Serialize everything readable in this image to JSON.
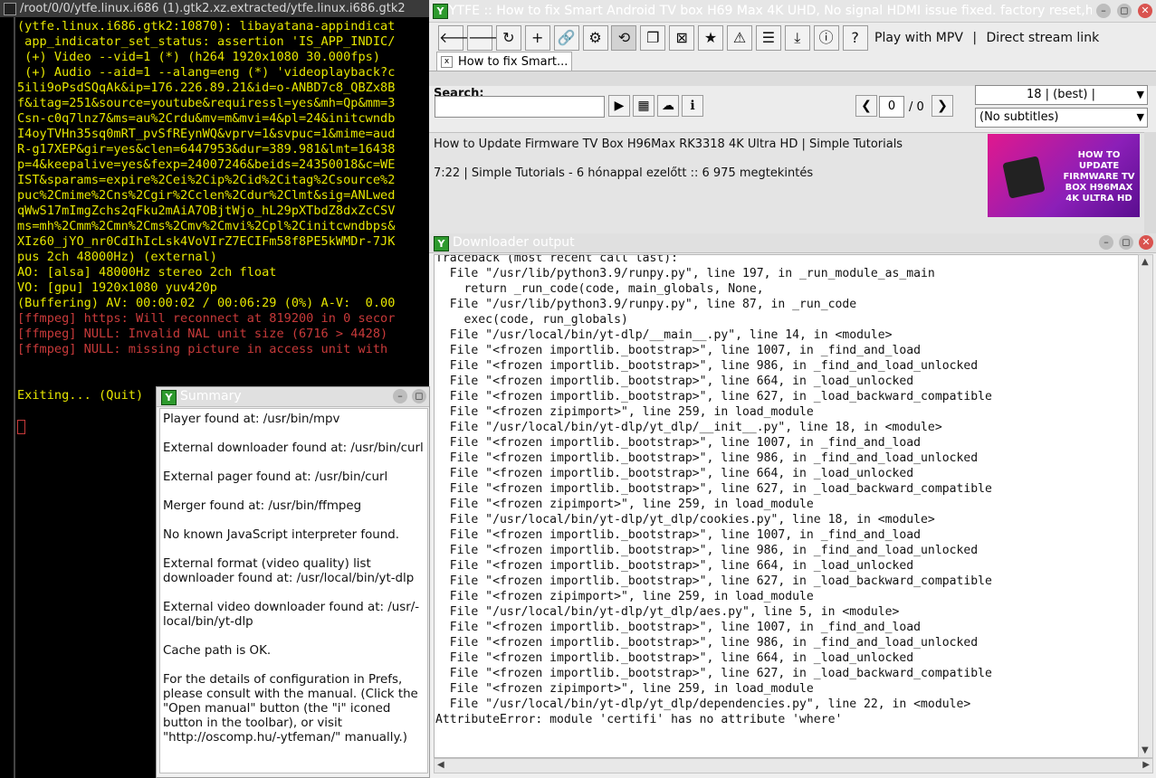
{
  "terminal": {
    "title": "/root/0/0/ytfe.linux.i686 (1).gtk2.xz.extracted/ytfe.linux.i686.gtk2",
    "lines": [
      {
        "text": "(ytfe.linux.i686.gtk2:10870): libayatana-appindicat",
        "red": false
      },
      {
        "text": " app_indicator_set_status: assertion 'IS_APP_INDIC/",
        "red": false
      },
      {
        "text": " (+) Video --vid=1 (*) (h264 1920x1080 30.000fps)",
        "red": false
      },
      {
        "text": " (+) Audio --aid=1 --alang=eng (*) 'videoplayback?c",
        "red": false
      },
      {
        "text": "5ili9oPsdSQqAk&ip=176.226.89.21&id=o-ANBD7c8_QBZx8B",
        "red": false
      },
      {
        "text": "f&itag=251&source=youtube&requiressl=yes&mh=Qp&mm=3",
        "red": false
      },
      {
        "text": "Csn-c0q7lnz7&ms=au%2Crdu&mv=m&mvi=4&pl=24&initcwndb",
        "red": false
      },
      {
        "text": "I4oyTVHn35sq0mRT_pvSfREynWQ&vprv=1&svpuc=1&mime=aud",
        "red": false
      },
      {
        "text": "R-g17XEP&gir=yes&clen=6447953&dur=389.981&lmt=16438",
        "red": false
      },
      {
        "text": "p=4&keepalive=yes&fexp=24007246&beids=24350018&c=WE",
        "red": false
      },
      {
        "text": "IST&sparams=expire%2Cei%2Cip%2Cid%2Citag%2Csource%2",
        "red": false
      },
      {
        "text": "puc%2Cmime%2Cns%2Cgir%2Cclen%2Cdur%2Clmt&sig=ANLwed",
        "red": false
      },
      {
        "text": "qWwS17mImgZchs2qFku2mAiA7OBjtWjo_hL29pXTbdZ8dxZcCSV",
        "red": false
      },
      {
        "text": "ms=mh%2Cmm%2Cmn%2Cms%2Cmv%2Cmvi%2Cpl%2Cinitcwndbps&",
        "red": false
      },
      {
        "text": "XIz60_jYO_nr0CdIhIcLsk4VoVIrZ7ECIFm58f8PE5kWMDr-7JK",
        "red": false
      },
      {
        "text": "pus 2ch 48000Hz) (external)",
        "red": false
      },
      {
        "text": "AO: [alsa] 48000Hz stereo 2ch float",
        "red": false
      },
      {
        "text": "VO: [gpu] 1920x1080 yuv420p",
        "red": false
      },
      {
        "text": "(Buffering) AV: 00:00:02 / 00:06:29 (0%) A-V:  0.00",
        "red": false
      },
      {
        "text": "[ffmpeg] https: Will reconnect at 819200 in 0 secor",
        "red": true
      },
      {
        "text": "[ffmpeg] NULL: Invalid NAL unit size (6716 > 4428)",
        "red": true
      },
      {
        "text": "[ffmpeg] NULL: missing picture in access unit with",
        "red": true
      },
      {
        "text": "",
        "red": false
      },
      {
        "text": "",
        "red": false
      },
      {
        "text": "Exiting... (Quit)",
        "red": false
      }
    ]
  },
  "ytfe": {
    "title": "YTFE :: How to fix Smart Android TV box H69 Max 4K UHD, No signal HDMI issue fixed. factory reset,hard res",
    "app_icon": "Y",
    "toolbar_icons": [
      "arrow-left-icon",
      "arrow-right-icon",
      "reload-icon",
      "plus-icon",
      "link-icon",
      "gear-icon",
      "history-icon",
      "copy-icon",
      "close-box-icon",
      "star-icon",
      "warning-icon",
      "list-icon",
      "download-icon",
      "info-icon",
      "help-icon"
    ],
    "toolbar_glyphs": [
      "🡐",
      "🡒",
      "↻",
      "+",
      "🔗",
      "⚙",
      "⟲",
      "❐",
      "⊠",
      "★",
      "⚠",
      "☰",
      "⤓",
      "ⓘ",
      "?"
    ],
    "play_mpv": "Play with MPV",
    "separator": "|",
    "direct_stream": "Direct stream link",
    "tab_label": "How to fix Smart...",
    "tab_close": "x",
    "search_label": "Search:",
    "search_value": "",
    "search_buttons": [
      "▶",
      "▦",
      "☁",
      "ℹ"
    ],
    "page_prev": "❮",
    "page_next": "❯",
    "page_current": "0",
    "page_total": "/ 0",
    "quality_select": "18 | (best) |",
    "subtitle_select": "(No subtitles)",
    "result_title": "How to Update Firmware TV Box H96Max RK3318 4K Ultra HD | Simple Tutorials",
    "result_meta": "7:22 | Simple Tutorials - 6 hónappal ezelőtt :: 6 975 megtekintés",
    "thumb_text": "HOW TO UPDATE FIRMWARE TV BOX H96MAX 4K ULTRA HD"
  },
  "downloader": {
    "title": "Downloader output",
    "lines": [
      "Traceback (most recent call last):",
      "  File \"/usr/lib/python3.9/runpy.py\", line 197, in _run_module_as_main",
      "    return _run_code(code, main_globals, None,",
      "  File \"/usr/lib/python3.9/runpy.py\", line 87, in _run_code",
      "    exec(code, run_globals)",
      "  File \"/usr/local/bin/yt-dlp/__main__.py\", line 14, in <module>",
      "  File \"<frozen importlib._bootstrap>\", line 1007, in _find_and_load",
      "  File \"<frozen importlib._bootstrap>\", line 986, in _find_and_load_unlocked",
      "  File \"<frozen importlib._bootstrap>\", line 664, in _load_unlocked",
      "  File \"<frozen importlib._bootstrap>\", line 627, in _load_backward_compatible",
      "  File \"<frozen zipimport>\", line 259, in load_module",
      "  File \"/usr/local/bin/yt-dlp/yt_dlp/__init__.py\", line 18, in <module>",
      "  File \"<frozen importlib._bootstrap>\", line 1007, in _find_and_load",
      "  File \"<frozen importlib._bootstrap>\", line 986, in _find_and_load_unlocked",
      "  File \"<frozen importlib._bootstrap>\", line 664, in _load_unlocked",
      "  File \"<frozen importlib._bootstrap>\", line 627, in _load_backward_compatible",
      "  File \"<frozen zipimport>\", line 259, in load_module",
      "  File \"/usr/local/bin/yt-dlp/yt_dlp/cookies.py\", line 18, in <module>",
      "  File \"<frozen importlib._bootstrap>\", line 1007, in _find_and_load",
      "  File \"<frozen importlib._bootstrap>\", line 986, in _find_and_load_unlocked",
      "  File \"<frozen importlib._bootstrap>\", line 664, in _load_unlocked",
      "  File \"<frozen importlib._bootstrap>\", line 627, in _load_backward_compatible",
      "  File \"<frozen zipimport>\", line 259, in load_module",
      "  File \"/usr/local/bin/yt-dlp/yt_dlp/aes.py\", line 5, in <module>",
      "  File \"<frozen importlib._bootstrap>\", line 1007, in _find_and_load",
      "  File \"<frozen importlib._bootstrap>\", line 986, in _find_and_load_unlocked",
      "  File \"<frozen importlib._bootstrap>\", line 664, in _load_unlocked",
      "  File \"<frozen importlib._bootstrap>\", line 627, in _load_backward_compatible",
      "  File \"<frozen zipimport>\", line 259, in load_module",
      "  File \"/usr/local/bin/yt-dlp/yt_dlp/dependencies.py\", line 22, in <module>",
      "AttributeError: module 'certifi' has no attribute 'where'"
    ]
  },
  "summary": {
    "title": "Summary",
    "paragraphs": [
      "Player found at: /usr/bin/mpv",
      "External downloader found at: /usr/bin/curl",
      "External pager found at: /usr/bin/curl",
      "Merger found at: /usr/bin/ffmpeg",
      "No known JavaScript interpreter found.",
      "External format (video quality) list downloader found at: /usr/local/bin/yt-dlp",
      "External video downloader found at: /usr/-local/bin/yt-dlp",
      "Cache path is OK.",
      "For the details of configuration in Prefs, please consult with the manual. (Click the \"Open manual\" button (the \"i\" iconed button in the toolbar), or visit \"http://oscomp.hu/-ytfeman/\" manually.)"
    ]
  },
  "window_buttons": {
    "minimize": "–",
    "maximize": "◻",
    "close": "✕"
  },
  "colors": {
    "terminal_yellow": "#e6e600",
    "terminal_red": "#c83a3a",
    "app_icon_green": "#2e9a2e"
  }
}
